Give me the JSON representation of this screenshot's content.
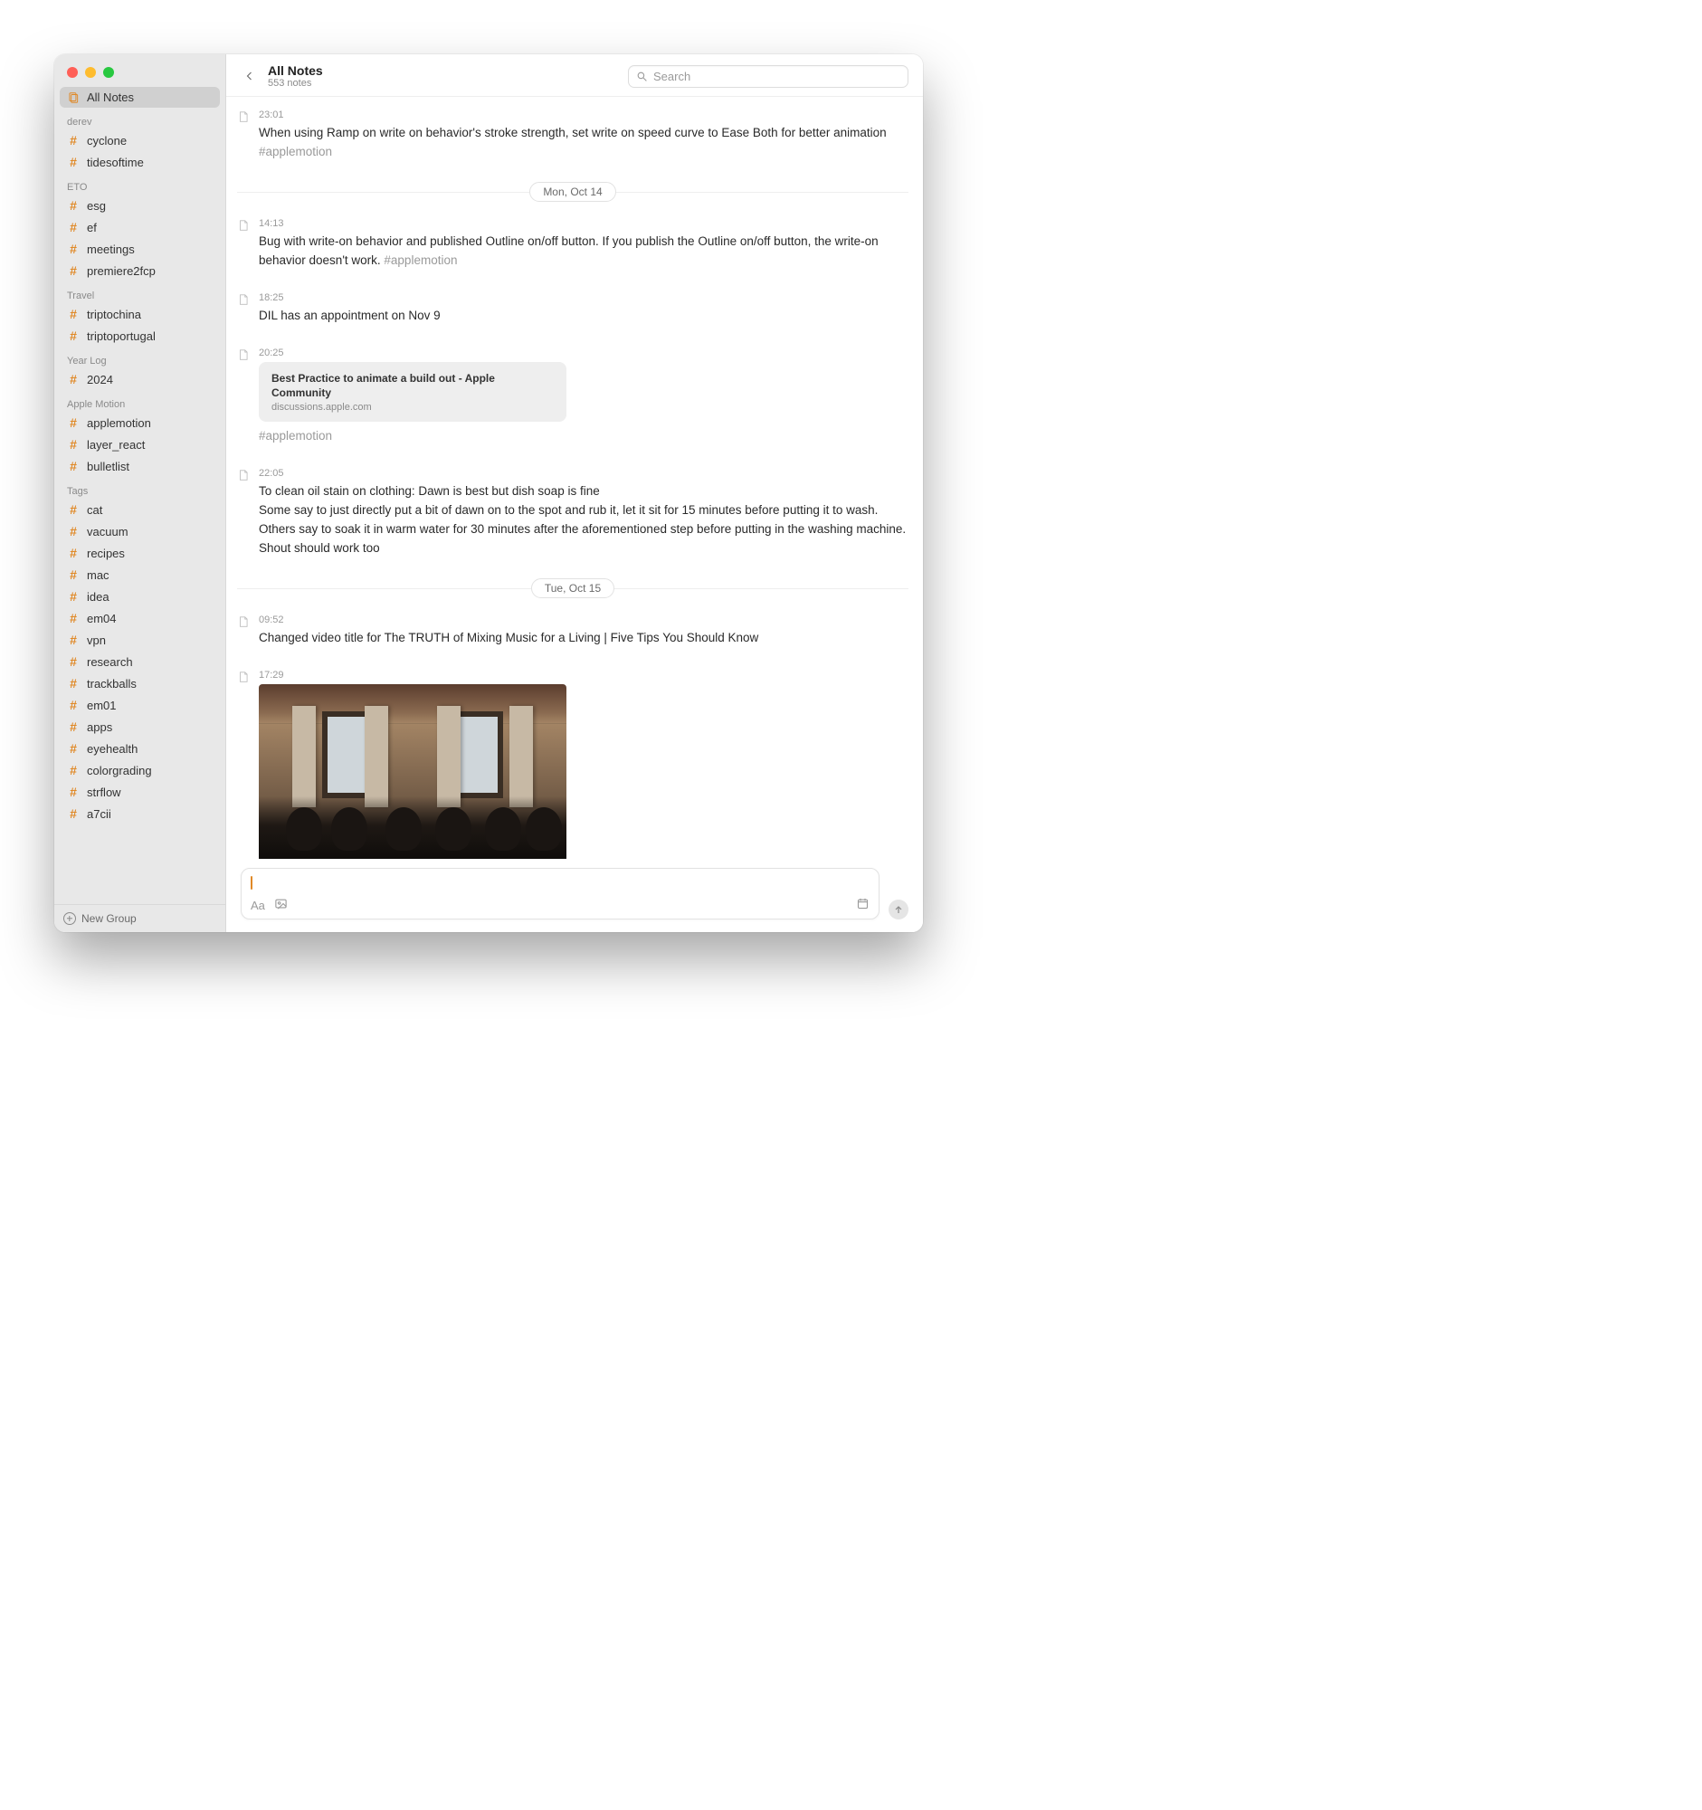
{
  "header": {
    "title": "All Notes",
    "subtitle": "553 notes"
  },
  "search": {
    "placeholder": "Search"
  },
  "sidebar": {
    "all_notes": "All Notes",
    "groups": [
      {
        "name": "derev",
        "items": [
          "cyclone",
          "tidesoftime"
        ]
      },
      {
        "name": "ETO",
        "items": [
          "esg",
          "ef",
          "meetings",
          "premiere2fcp"
        ]
      },
      {
        "name": "Travel",
        "items": [
          "triptochina",
          "triptoportugal"
        ]
      },
      {
        "name": "Year Log",
        "items": [
          "2024"
        ]
      },
      {
        "name": "Apple Motion",
        "items": [
          "applemotion",
          "layer_react",
          "bulletlist"
        ]
      },
      {
        "name": "Tags",
        "items": [
          "cat",
          "vacuum",
          "recipes",
          "mac",
          "idea",
          "em04",
          "vpn",
          "research",
          "trackballs",
          "em01",
          "apps",
          "eyehealth",
          "colorgrading",
          "strflow",
          "a7cii"
        ]
      }
    ],
    "new_group": "New Group"
  },
  "dates": {
    "d1": "Mon, Oct 14",
    "d2": "Tue, Oct 15"
  },
  "notes": {
    "n0": {
      "ts": "23:01",
      "text": "When using Ramp on write on behavior's stroke strength, set write on speed curve to Ease Both for better animation ",
      "tag": "#applemotion"
    },
    "n1": {
      "ts": "14:13",
      "text": "Bug with write-on behavior and published Outline on/off button. If you publish the Outline on/off button, the write-on behavior doesn't work.    ",
      "tag": "#applemotion"
    },
    "n2": {
      "ts": "18:25",
      "text": "DIL has an appointment on Nov 9"
    },
    "n3": {
      "ts": "20:25",
      "link_title": "Best Practice to animate a build out - Apple Community",
      "link_domain": "discussions.apple.com",
      "tag": "#applemotion"
    },
    "n4": {
      "ts": "22:05",
      "text1": "To clean oil stain on clothing: Dawn is best but dish soap is fine",
      "text2": "Some say to just directly put a bit of dawn on to the spot and rub it, let it sit for 15 minutes before putting it to wash. Others say to soak it in warm water for 30 minutes after the aforementioned step before putting in the washing machine. Shout should work too"
    },
    "n5": {
      "ts": "09:52",
      "text": "Changed video title for The TRUTH of Mixing Music for a Living | Five Tips You Should Know"
    },
    "n6": {
      "ts": "17:29",
      "alt": "photo of people at tables in a tall-windowed room"
    }
  },
  "composer": {
    "aa": "Aa"
  }
}
